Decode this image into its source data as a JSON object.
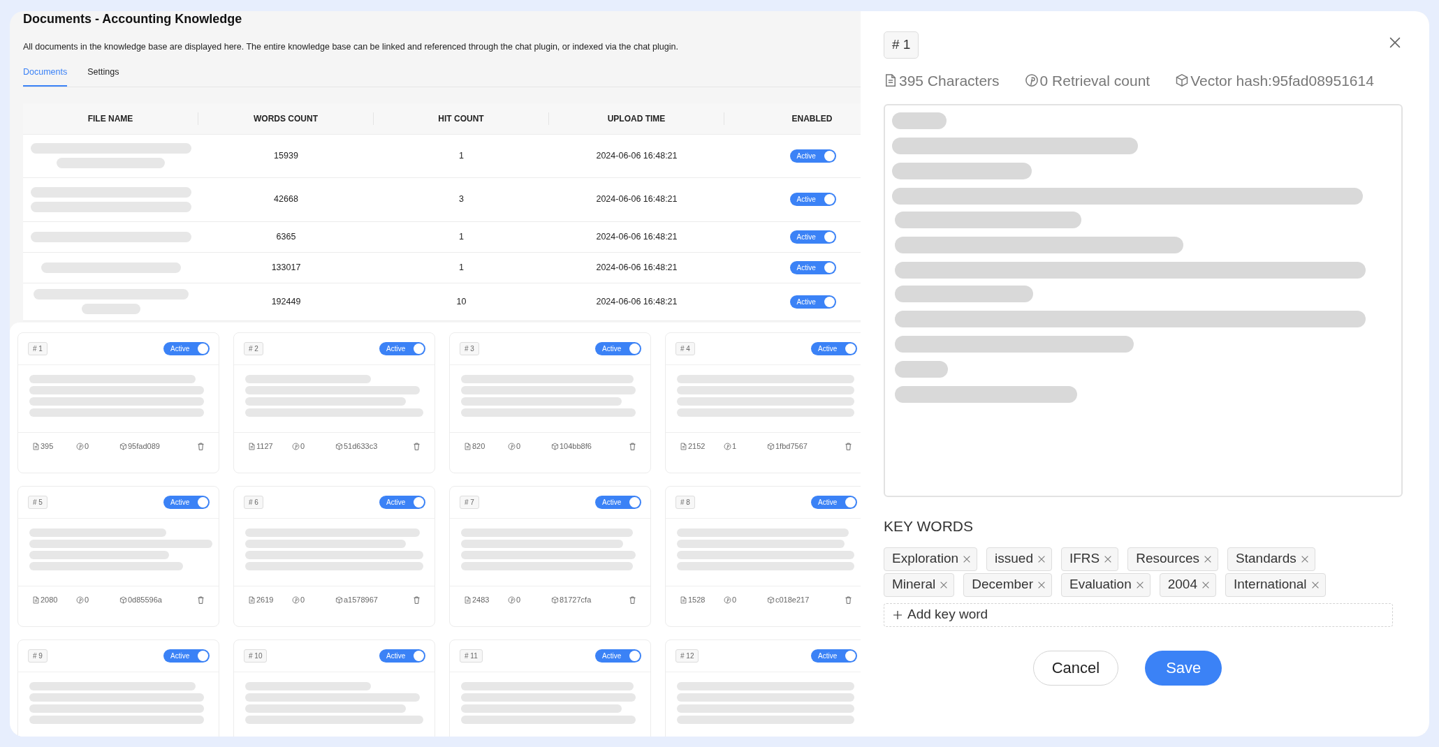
{
  "page": {
    "title": "Documents - Accounting Knowledge",
    "description": "All documents in the knowledge base are displayed here. The entire knowledge base can be linked and referenced through the chat plugin, or indexed via the chat plugin."
  },
  "tabs": [
    {
      "label": "Documents",
      "selected": true
    },
    {
      "label": "Settings",
      "selected": false
    }
  ],
  "table": {
    "columns": [
      "FILE NAME",
      "WORDS COUNT",
      "HIT COUNT",
      "UPLOAD TIME",
      "ENABLED"
    ],
    "rows": [
      {
        "words_count": "15939",
        "hit_count": "1",
        "upload_time": "2024-06-06 16:48:21",
        "enabled": {
          "label": "Active",
          "on": true
        }
      },
      {
        "words_count": "42668",
        "hit_count": "3",
        "upload_time": "2024-06-06 16:48:21",
        "enabled": {
          "label": "Active",
          "on": true
        }
      },
      {
        "words_count": "6365",
        "hit_count": "1",
        "upload_time": "2024-06-06 16:48:21",
        "enabled": {
          "label": "Active",
          "on": true
        }
      },
      {
        "words_count": "133017",
        "hit_count": "1",
        "upload_time": "2024-06-06 16:48:21",
        "enabled": {
          "label": "Active",
          "on": true
        }
      },
      {
        "words_count": "192449",
        "hit_count": "10",
        "upload_time": "2024-06-06 16:48:21",
        "enabled": {
          "label": "Active",
          "on": true
        }
      }
    ]
  },
  "chunks": [
    {
      "number": "# 1",
      "toggle": {
        "label": "Active",
        "on": true
      },
      "characters": "395",
      "retrievals": "0",
      "hash": "95fad089"
    },
    {
      "number": "# 2",
      "toggle": {
        "label": "Active",
        "on": true
      },
      "characters": "1127",
      "retrievals": "0",
      "hash": "51d633c3"
    },
    {
      "number": "# 3",
      "toggle": {
        "label": "Active",
        "on": true
      },
      "characters": "820",
      "retrievals": "0",
      "hash": "104bb8f6"
    },
    {
      "number": "# 4",
      "toggle": {
        "label": "Active",
        "on": true
      },
      "characters": "2152",
      "retrievals": "1",
      "hash": "1fbd7567"
    },
    {
      "number": "# 5",
      "toggle": {
        "label": "Active",
        "on": true
      },
      "characters": "2080",
      "retrievals": "0",
      "hash": "0d85596a"
    },
    {
      "number": "# 6",
      "toggle": {
        "label": "Active",
        "on": true
      },
      "characters": "2619",
      "retrievals": "0",
      "hash": "a1578967"
    },
    {
      "number": "# 7",
      "toggle": {
        "label": "Active",
        "on": true
      },
      "characters": "2483",
      "retrievals": "0",
      "hash": "81727cfa"
    },
    {
      "number": "# 8",
      "toggle": {
        "label": "Active",
        "on": true
      },
      "characters": "1528",
      "retrievals": "0",
      "hash": "c018e217"
    },
    {
      "number": "# 9",
      "toggle": {
        "label": "Active",
        "on": true
      }
    },
    {
      "number": "# 10",
      "toggle": {
        "label": "Active",
        "on": true
      }
    },
    {
      "number": "# 11",
      "toggle": {
        "label": "Active",
        "on": true
      }
    },
    {
      "number": "# 12",
      "toggle": {
        "label": "Active",
        "on": true
      }
    }
  ],
  "detail": {
    "number": "# 1",
    "characters": "395 Characters",
    "retrievals": "0 Retrieval count",
    "hash": "Vector hash:95fad08951614",
    "keywords_title": "KEY WORDS",
    "keywords": [
      "Exploration",
      "issued",
      "IFRS",
      "Resources",
      "Standards",
      "Mineral",
      "December",
      "Evaluation",
      "2004",
      "International"
    ],
    "add_keyword": "Add key word",
    "cancel": "Cancel",
    "save": "Save"
  }
}
